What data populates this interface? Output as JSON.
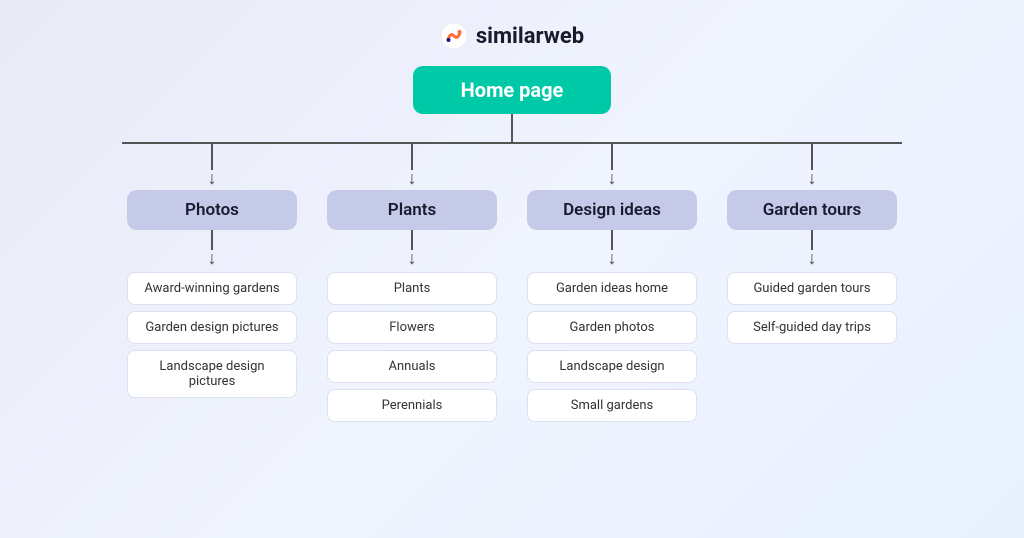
{
  "logo": {
    "text": "similarweb"
  },
  "root": {
    "label": "Home page"
  },
  "categories": [
    {
      "label": "Photos",
      "items": [
        "Award-winning gardens",
        "Garden design pictures",
        "Landscape design pictures"
      ]
    },
    {
      "label": "Plants",
      "items": [
        "Plants",
        "Flowers",
        "Annuals",
        "Perennials"
      ]
    },
    {
      "label": "Design ideas",
      "items": [
        "Garden ideas home",
        "Garden photos",
        "Landscape design",
        "Small gardens"
      ]
    },
    {
      "label": "Garden tours",
      "items": [
        "Guided garden tours",
        "Self-guided day trips"
      ]
    }
  ]
}
